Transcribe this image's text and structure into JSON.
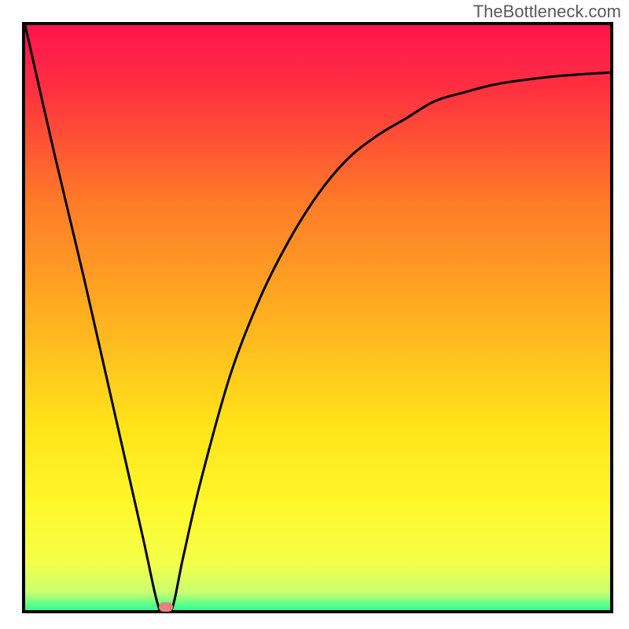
{
  "watermark": "TheBottleneck.com",
  "colors": {
    "top": "#ff1450",
    "mid_upper": "#ff7a28",
    "mid": "#ffd21a",
    "mid_lower": "#fff82a",
    "bottom": "#2cff98",
    "border": "#000000",
    "curve": "#000000",
    "marker": "#e8817d"
  },
  "chart_data": {
    "type": "line",
    "title": "",
    "xlabel": "",
    "ylabel": "",
    "xlim": [
      0,
      100
    ],
    "ylim": [
      0,
      100
    ],
    "grid": false,
    "series": [
      {
        "name": "bottleneck-curve",
        "x": [
          0,
          5,
          10,
          15,
          20,
          23,
          25,
          27,
          30,
          35,
          40,
          45,
          50,
          55,
          60,
          65,
          70,
          75,
          80,
          85,
          90,
          95,
          100
        ],
        "y": [
          100,
          78,
          57,
          35,
          13,
          0,
          0,
          9,
          22,
          40,
          53,
          63,
          71,
          77,
          81,
          84,
          87,
          88.5,
          89.8,
          90.6,
          91.2,
          91.6,
          91.9
        ]
      }
    ],
    "annotations": [
      {
        "name": "min-marker",
        "x": 24,
        "y": 0.5
      }
    ],
    "background_gradient": [
      {
        "stop": 0,
        "color": "#ff1450"
      },
      {
        "stop": 45,
        "color": "#ffb020"
      },
      {
        "stop": 70,
        "color": "#fff82a"
      },
      {
        "stop": 96,
        "color": "#e6ff60"
      },
      {
        "stop": 100,
        "color": "#2cff98"
      }
    ]
  }
}
